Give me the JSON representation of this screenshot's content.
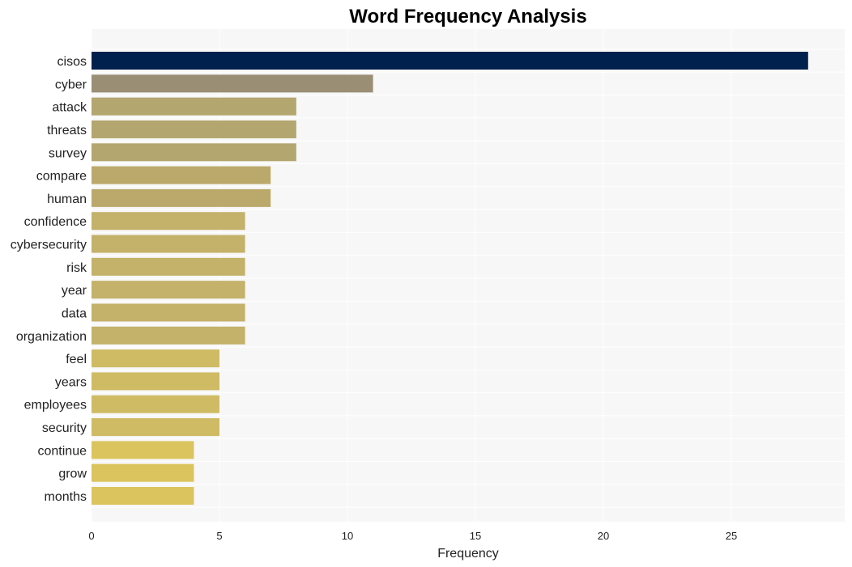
{
  "chart_data": {
    "type": "bar",
    "orientation": "horizontal",
    "title": "Word Frequency Analysis",
    "xlabel": "Frequency",
    "ylabel": "",
    "xlim": [
      0,
      28.5
    ],
    "xticks": [
      0,
      5,
      10,
      15,
      20,
      25
    ],
    "grid": true,
    "categories": [
      "cisos",
      "cyber",
      "attack",
      "threats",
      "survey",
      "compare",
      "human",
      "confidence",
      "cybersecurity",
      "risk",
      "year",
      "data",
      "organization",
      "feel",
      "years",
      "employees",
      "security",
      "continue",
      "grow",
      "months"
    ],
    "values": [
      28,
      11,
      8,
      8,
      8,
      7,
      7,
      6,
      6,
      6,
      6,
      6,
      6,
      5,
      5,
      5,
      5,
      4,
      4,
      4
    ],
    "colors": [
      "#00214d",
      "#9a8f74",
      "#b3a66e",
      "#b3a66e",
      "#b3a66e",
      "#bba96c",
      "#bba96c",
      "#c4b16a",
      "#c4b16a",
      "#c4b16a",
      "#c4b16a",
      "#c4b16a",
      "#c4b16a",
      "#cfbb63",
      "#cfbb63",
      "#cfbb63",
      "#cfbb63",
      "#dbc45e",
      "#dbc45e",
      "#dbc45e"
    ],
    "background": "#f7f7f7"
  }
}
